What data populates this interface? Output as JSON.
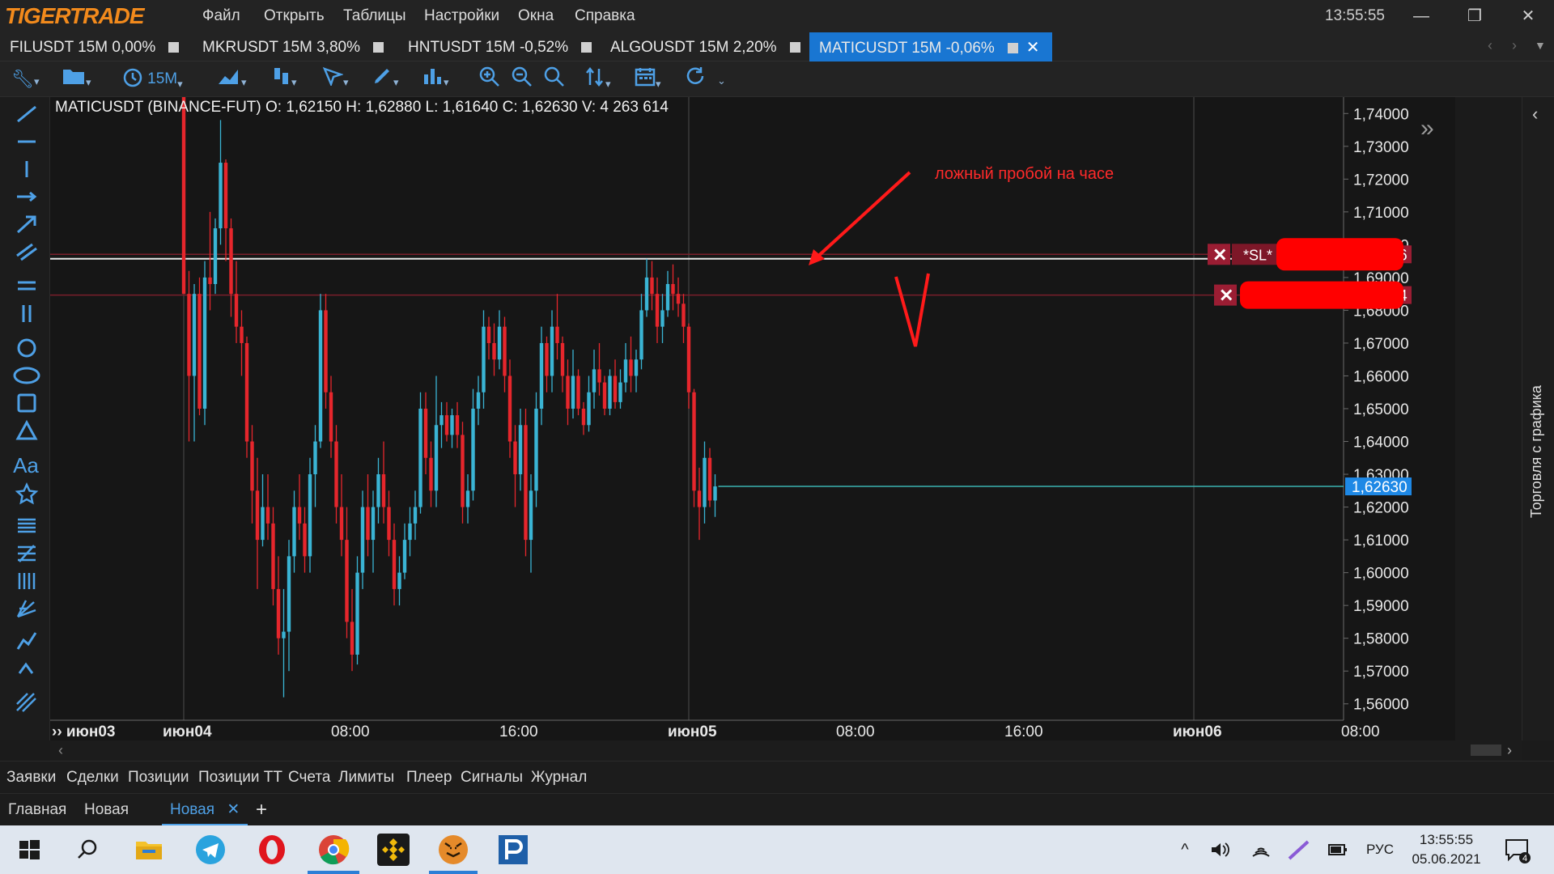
{
  "app": {
    "logo": "TIGERTRADE",
    "clock": "13:55:55"
  },
  "menu": [
    "Файл",
    "Открыть",
    "Таблицы",
    "Настройки",
    "Окна",
    "Справка"
  ],
  "window_controls": {
    "minimize": "—",
    "maximize": "❐",
    "close": "✕"
  },
  "tabs": [
    {
      "label": "FILUSDT 15M 0,00%"
    },
    {
      "label": "MKRUSDT 15M 3,80%"
    },
    {
      "label": "HNTUSDT 15M -0,52%"
    },
    {
      "label": "ALGOUSDT 15M 2,20%"
    },
    {
      "label": "MATICUSDT 15M -0,06%",
      "active": true
    }
  ],
  "toolbar": {
    "timeframe": "15M"
  },
  "chart": {
    "ohlc_line": "MATICUSDT (BINANCE-FUT)  O: 1,62150  H: 1,62880  L: 1,61640  C: 1,62630  V: 4 263 614",
    "annotation": "ложный пробой на часе",
    "sl_tag": "*SL*",
    "order_x": "✕",
    "right_panel_label": "Торговля с графика"
  },
  "chart_data": {
    "type": "candlestick",
    "symbol": "MATICUSDT",
    "exchange": "BINANCE-FUT",
    "timeframe": "15M",
    "ylim": [
      1.555,
      1.745
    ],
    "y_ticks": [
      "1,74000",
      "1,73000",
      "1,72000",
      "1,71000",
      "1,70000",
      "1,69000",
      "1,68000",
      "1,67000",
      "1,66000",
      "1,65000",
      "1,64000",
      "1,63000",
      "1,62000",
      "1,61000",
      "1,60000",
      "1,59000",
      "1,58000",
      "1,57000",
      "1,56000"
    ],
    "x_ticks": [
      {
        "label": "июн03",
        "bar": -19
      },
      {
        "label": "июн04",
        "bar": 0
      },
      {
        "label": "08:00",
        "bar": 32
      },
      {
        "label": "16:00",
        "bar": 64
      },
      {
        "label": "июн05",
        "bar": 96
      },
      {
        "label": "08:00",
        "bar": 128
      },
      {
        "label": "16:00",
        "bar": 160
      },
      {
        "label": "июн06",
        "bar": 192
      },
      {
        "label": "08:00",
        "bar": 224
      }
    ],
    "price_levels": [
      {
        "label": "1,69706",
        "value": 1.69706,
        "kind": "order"
      },
      {
        "label": "1,68464",
        "value": 1.68464,
        "kind": "order"
      },
      {
        "label": "1,62630",
        "value": 1.6263,
        "kind": "last"
      }
    ],
    "resistance_level": 1.6957,
    "candles": [
      [
        1.75,
        1.75,
        1.685,
        1.685
      ],
      [
        1.685,
        1.692,
        1.64,
        1.66
      ],
      [
        1.66,
        1.688,
        1.64,
        1.685
      ],
      [
        1.685,
        1.69,
        1.648,
        1.65
      ],
      [
        1.65,
        1.695,
        1.645,
        1.69
      ],
      [
        1.69,
        1.71,
        1.68,
        1.688
      ],
      [
        1.688,
        1.708,
        1.685,
        1.705
      ],
      [
        1.705,
        1.738,
        1.7,
        1.725
      ],
      [
        1.725,
        1.726,
        1.695,
        1.705
      ],
      [
        1.705,
        1.708,
        1.678,
        1.685
      ],
      [
        1.685,
        1.695,
        1.67,
        1.675
      ],
      [
        1.675,
        1.68,
        1.66,
        1.67
      ],
      [
        1.67,
        1.672,
        1.635,
        1.64
      ],
      [
        1.64,
        1.645,
        1.615,
        1.625
      ],
      [
        1.625,
        1.635,
        1.595,
        1.61
      ],
      [
        1.61,
        1.63,
        1.608,
        1.62
      ],
      [
        1.62,
        1.63,
        1.61,
        1.615
      ],
      [
        1.615,
        1.62,
        1.59,
        1.595
      ],
      [
        1.595,
        1.605,
        1.575,
        1.58
      ],
      [
        1.58,
        1.595,
        1.562,
        1.582
      ],
      [
        1.582,
        1.61,
        1.57,
        1.605
      ],
      [
        1.605,
        1.625,
        1.6,
        1.62
      ],
      [
        1.62,
        1.63,
        1.61,
        1.615
      ],
      [
        1.615,
        1.62,
        1.6,
        1.605
      ],
      [
        1.605,
        1.635,
        1.6,
        1.63
      ],
      [
        1.63,
        1.645,
        1.62,
        1.64
      ],
      [
        1.64,
        1.685,
        1.638,
        1.68
      ],
      [
        1.68,
        1.685,
        1.65,
        1.655
      ],
      [
        1.655,
        1.66,
        1.635,
        1.64
      ],
      [
        1.64,
        1.645,
        1.615,
        1.62
      ],
      [
        1.62,
        1.63,
        1.605,
        1.61
      ],
      [
        1.61,
        1.62,
        1.58,
        1.585
      ],
      [
        1.585,
        1.595,
        1.57,
        1.575
      ],
      [
        1.575,
        1.605,
        1.572,
        1.6
      ],
      [
        1.6,
        1.625,
        1.595,
        1.62
      ],
      [
        1.62,
        1.63,
        1.605,
        1.61
      ],
      [
        1.61,
        1.625,
        1.6,
        1.62
      ],
      [
        1.62,
        1.635,
        1.615,
        1.63
      ],
      [
        1.63,
        1.64,
        1.615,
        1.62
      ],
      [
        1.62,
        1.625,
        1.605,
        1.61
      ],
      [
        1.61,
        1.615,
        1.59,
        1.595
      ],
      [
        1.595,
        1.605,
        1.59,
        1.6
      ],
      [
        1.6,
        1.615,
        1.598,
        1.61
      ],
      [
        1.61,
        1.62,
        1.605,
        1.615
      ],
      [
        1.615,
        1.625,
        1.61,
        1.62
      ],
      [
        1.62,
        1.655,
        1.618,
        1.65
      ],
      [
        1.65,
        1.655,
        1.63,
        1.635
      ],
      [
        1.635,
        1.64,
        1.62,
        1.625
      ],
      [
        1.625,
        1.66,
        1.62,
        1.645
      ],
      [
        1.645,
        1.652,
        1.638,
        1.648
      ],
      [
        1.648,
        1.652,
        1.64,
        1.642
      ],
      [
        1.642,
        1.65,
        1.638,
        1.648
      ],
      [
        1.648,
        1.652,
        1.638,
        1.642
      ],
      [
        1.642,
        1.646,
        1.615,
        1.62
      ],
      [
        1.62,
        1.63,
        1.615,
        1.625
      ],
      [
        1.625,
        1.656,
        1.622,
        1.65
      ],
      [
        1.65,
        1.66,
        1.645,
        1.655
      ],
      [
        1.655,
        1.68,
        1.65,
        1.675
      ],
      [
        1.675,
        1.678,
        1.665,
        1.67
      ],
      [
        1.67,
        1.676,
        1.66,
        1.665
      ],
      [
        1.665,
        1.68,
        1.662,
        1.675
      ],
      [
        1.675,
        1.678,
        1.655,
        1.66
      ],
      [
        1.66,
        1.665,
        1.635,
        1.64
      ],
      [
        1.64,
        1.645,
        1.62,
        1.63
      ],
      [
        1.63,
        1.65,
        1.625,
        1.645
      ],
      [
        1.645,
        1.65,
        1.605,
        1.61
      ],
      [
        1.61,
        1.63,
        1.6,
        1.625
      ],
      [
        1.625,
        1.655,
        1.62,
        1.65
      ],
      [
        1.65,
        1.675,
        1.645,
        1.67
      ],
      [
        1.67,
        1.672,
        1.655,
        1.66
      ],
      [
        1.66,
        1.68,
        1.655,
        1.675
      ],
      [
        1.675,
        1.685,
        1.665,
        1.67
      ],
      [
        1.67,
        1.672,
        1.655,
        1.66
      ],
      [
        1.66,
        1.665,
        1.645,
        1.65
      ],
      [
        1.65,
        1.668,
        1.647,
        1.66
      ],
      [
        1.66,
        1.662,
        1.648,
        1.65
      ],
      [
        1.65,
        1.652,
        1.642,
        1.645
      ],
      [
        1.645,
        1.66,
        1.643,
        1.655
      ],
      [
        1.655,
        1.668,
        1.65,
        1.662
      ],
      [
        1.662,
        1.67,
        1.654,
        1.658
      ],
      [
        1.658,
        1.66,
        1.648,
        1.65
      ],
      [
        1.65,
        1.662,
        1.648,
        1.66
      ],
      [
        1.66,
        1.665,
        1.65,
        1.652
      ],
      [
        1.652,
        1.662,
        1.65,
        1.658
      ],
      [
        1.658,
        1.67,
        1.655,
        1.665
      ],
      [
        1.665,
        1.672,
        1.655,
        1.66
      ],
      [
        1.66,
        1.668,
        1.655,
        1.665
      ],
      [
        1.665,
        1.685,
        1.662,
        1.68
      ],
      [
        1.68,
        1.6957,
        1.678,
        1.69
      ],
      [
        1.69,
        1.695,
        1.68,
        1.685
      ],
      [
        1.685,
        1.69,
        1.67,
        1.675
      ],
      [
        1.675,
        1.685,
        1.67,
        1.68
      ],
      [
        1.68,
        1.692,
        1.678,
        1.688
      ],
      [
        1.688,
        1.694,
        1.68,
        1.685
      ],
      [
        1.685,
        1.69,
        1.678,
        1.682
      ],
      [
        1.682,
        1.685,
        1.67,
        1.675
      ],
      [
        1.675,
        1.676,
        1.65,
        1.655
      ],
      [
        1.655,
        1.656,
        1.62,
        1.625
      ],
      [
        1.625,
        1.632,
        1.61,
        1.62
      ],
      [
        1.62,
        1.64,
        1.615,
        1.635
      ],
      [
        1.635,
        1.638,
        1.62,
        1.622
      ],
      [
        1.622,
        1.63,
        1.617,
        1.6263
      ]
    ]
  },
  "bottom_tabs": [
    "Заявки",
    "Сделки",
    "Позиции",
    "Позиции ТТ",
    "Счета",
    "Лимиты",
    "Плеер",
    "Сигналы",
    "Журнал"
  ],
  "workspaces": {
    "items": [
      "Главная",
      "Новая",
      "Новая"
    ],
    "active_index": 2,
    "add": "+",
    "close": "✕"
  },
  "taskbar": {
    "time": "13:55:55",
    "date": "05.06.2021",
    "lang": "РУС",
    "notif_count": "4"
  }
}
